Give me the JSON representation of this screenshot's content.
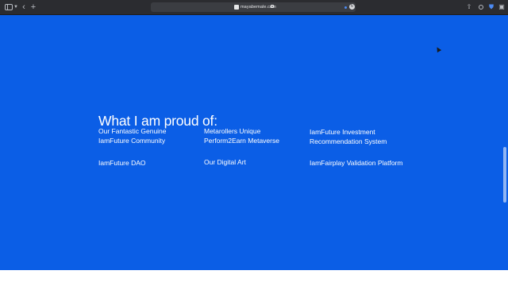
{
  "browser": {
    "url": "mayabemale.com",
    "icons": [
      "sidebar-toggle-icon",
      "chevron-down-icon",
      "back-icon",
      "plus-icon",
      "lock-icon",
      "reload-icon",
      "share-icon",
      "download-icon",
      "shield-icon",
      "extensions-icon"
    ]
  },
  "section": {
    "heading": "What I am proud of:",
    "items": [
      {
        "line1": "Our Fantastic Genuine",
        "line2": "IamFuture Community"
      },
      {
        "line1": "Metarollers Unique",
        "line2": "Perform2Earn Metaverse"
      },
      {
        "line1": "IamFuture Investment",
        "line2": "Recommendation System"
      },
      {
        "line1": "IamFuture DAO",
        "line2": ""
      },
      {
        "line1": "Our Digital Art",
        "line2": ""
      },
      {
        "line1": "IamFairplay Validation Platform",
        "line2": ""
      }
    ]
  },
  "colors": {
    "page_background": "#0b5ee6",
    "text": "#ffffff",
    "toolbar": "#2b2c30"
  }
}
